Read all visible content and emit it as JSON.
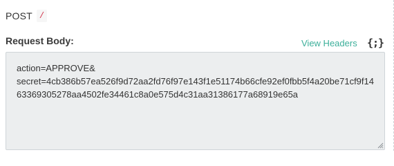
{
  "request": {
    "method": "POST",
    "path": "/"
  },
  "body_section": {
    "label": "Request Body:",
    "view_headers_label": "View Headers",
    "toggle_icon": "curly-braces-icon",
    "toggle_glyph": "{;}",
    "content": "action=APPROVE&\nsecret=4cb386b57ea526f9d72aa2fd76f97e143f1e51174b66cfe92ef0fbb5f4a20be71cf9f1463369305278aa4502fe34461c8a0e575d4c31aa31386177a68919e65a"
  },
  "colors": {
    "accent": "#3caf9a",
    "code_path": "#d1334b",
    "body_background": "#eceeef"
  }
}
